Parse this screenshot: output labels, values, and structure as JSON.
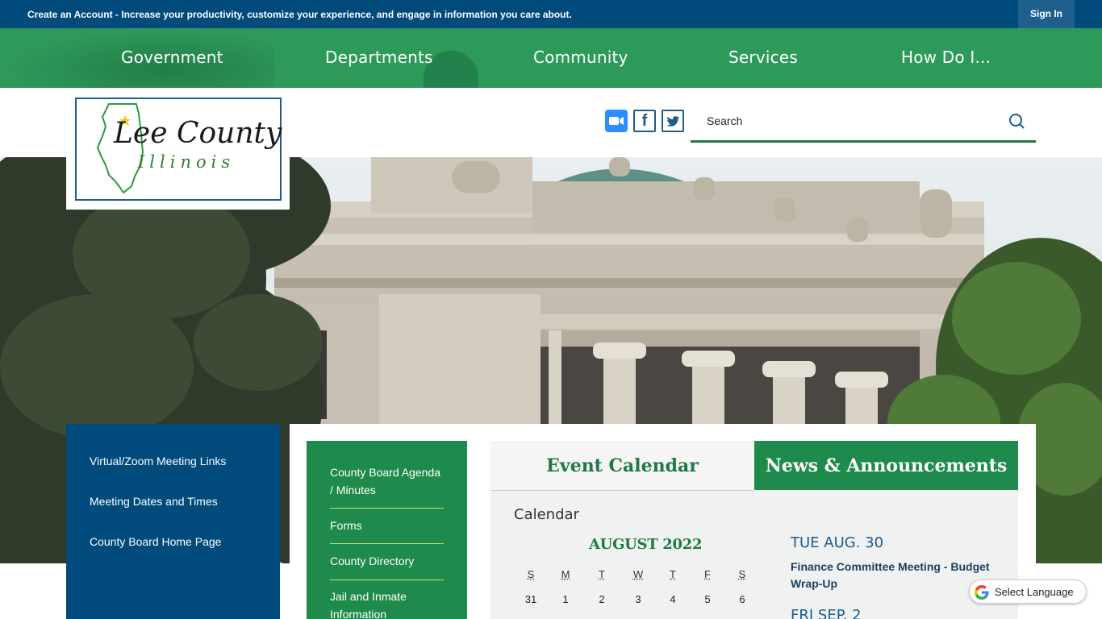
{
  "topbar": {
    "account_lead": "Create an Account",
    "account_text": " - Increase your productivity, customize your experience, and engage in information you care about.",
    "signin_label": "Sign In"
  },
  "nav": {
    "items": [
      "Government",
      "Departments",
      "Community",
      "Services",
      "How Do I..."
    ]
  },
  "logo": {
    "title": "Lee County",
    "subtitle": "Illinois"
  },
  "social": {
    "icons": [
      "zoom-icon",
      "facebook-icon",
      "twitter-icon"
    ]
  },
  "search": {
    "placeholder": "Search"
  },
  "quick_links": [
    "Virtual/Zoom Meeting Links",
    "Meeting Dates and Times",
    "County Board Home Page"
  ],
  "green_links": [
    "County Board Agenda / Minutes",
    "Forms",
    "County Directory",
    "Jail and Inmate Information"
  ],
  "tabs": {
    "calendar": "Event Calendar",
    "news": "News & Announcements"
  },
  "calendar": {
    "heading": "Calendar",
    "month": "AUGUST 2022",
    "days_of_week": [
      "S",
      "M",
      "T",
      "W",
      "T",
      "F",
      "S"
    ],
    "first_week": [
      "31",
      "1",
      "2",
      "3",
      "4",
      "5",
      "6"
    ]
  },
  "events": [
    {
      "date": "TUE AUG. 30",
      "title": "Finance Committee Meeting - Budget Wrap-Up"
    },
    {
      "date": "FRI SEP. 2",
      "title": ""
    }
  ],
  "translate": {
    "label": "Select Language"
  },
  "colors": {
    "topbar": "#004a7c",
    "nav": "#2e9a5a",
    "green_accent": "#1e8a4c",
    "blue_accent": "#1d5c8d"
  }
}
